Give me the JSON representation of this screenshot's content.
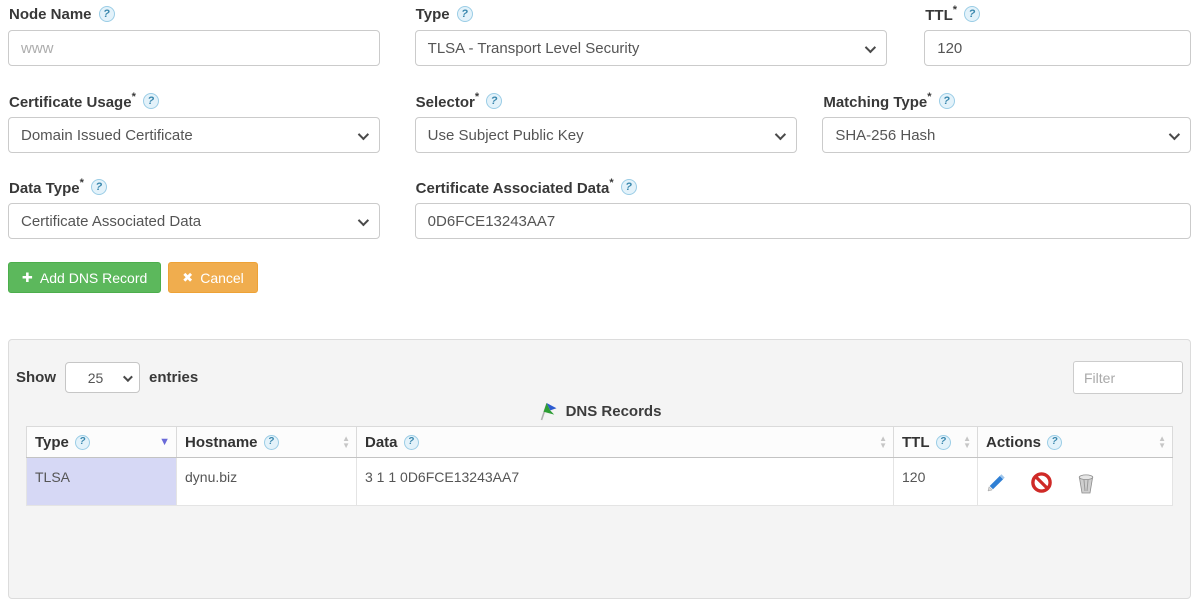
{
  "required_mark": "*",
  "icons": {
    "help": "?",
    "add": "✚",
    "cancel": "✖",
    "sort_asc": "▲",
    "sort_desc": "▼"
  },
  "colors": {
    "add_button_green": "#5cb85c",
    "cancel_button_orange": "#f0ad4e",
    "sorted_cell_lavender": "#d6d8f5",
    "help_icon_blue": "#3a87ad",
    "sorted_arrow_purple": "#6a6ad8"
  },
  "form": {
    "node_name": {
      "label": "Node Name",
      "placeholder": "www",
      "value": ""
    },
    "type": {
      "label": "Type",
      "value": "TLSA - Transport Level Security"
    },
    "ttl": {
      "label": "TTL",
      "value": "120"
    },
    "certificate_usage": {
      "label": "Certificate Usage",
      "value": "Domain Issued Certificate"
    },
    "selector": {
      "label": "Selector",
      "value": "Use Subject Public Key"
    },
    "matching_type": {
      "label": "Matching Type",
      "value": "SHA-256 Hash"
    },
    "data_type": {
      "label": "Data Type",
      "value": "Certificate Associated Data"
    },
    "certificate_associated_data": {
      "label": "Certificate Associated Data",
      "value": "0D6FCE13243AA7"
    },
    "add_button": "Add DNS Record",
    "cancel_button": "Cancel"
  },
  "records_panel": {
    "show_label": "Show",
    "page_size": "25",
    "entries_label": "entries",
    "filter_placeholder": "Filter",
    "title": "DNS Records",
    "columns": [
      {
        "label": "Type",
        "sort": "desc"
      },
      {
        "label": "Hostname",
        "sort": "both"
      },
      {
        "label": "Data",
        "sort": "both"
      },
      {
        "label": "TTL",
        "sort": "both"
      },
      {
        "label": "Actions",
        "sort": "both"
      }
    ],
    "rows": [
      {
        "type": "TLSA",
        "hostname": "dynu.biz",
        "data": "3 1 1 0D6FCE13243AA7",
        "ttl": "120"
      }
    ]
  }
}
